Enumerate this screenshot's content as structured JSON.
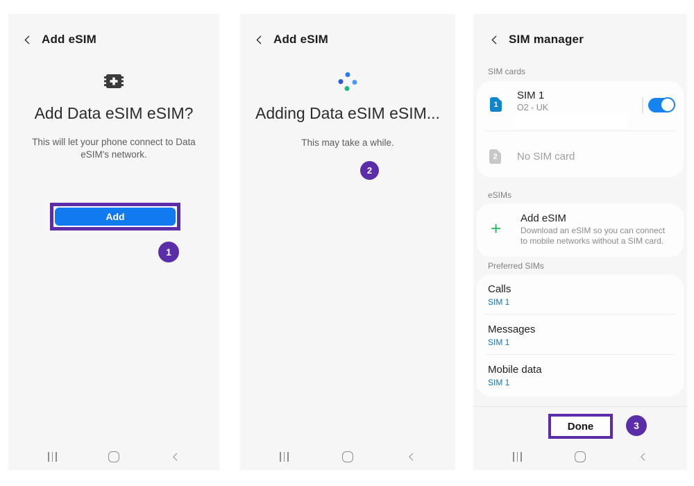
{
  "colors": {
    "accent_blue": "#127af0",
    "toggle_blue": "#1583f0",
    "sim_badge_blue": "#0e86c7",
    "plus_green": "#2eb567",
    "link_blue": "#1474c4",
    "annotation_purple": "#5b2da8",
    "spinner_top": "#2b7bf0",
    "spinner_left": "#2b59cf",
    "spinner_right": "#459bf5",
    "spinner_bottom": "#1bb97e"
  },
  "screen1": {
    "header": {
      "title": "Add eSIM"
    },
    "heading": "Add Data eSIM eSIM?",
    "body": "This will let your phone connect to Data eSIM's network.",
    "add_button": "Add",
    "badge": "1"
  },
  "screen2": {
    "header": {
      "title": "Add eSIM"
    },
    "heading": "Adding Data eSIM eSIM...",
    "body": "This may take a while.",
    "badge": "2"
  },
  "screen3": {
    "header": {
      "title": "SIM manager"
    },
    "sim_cards_label": "SIM cards",
    "sim1": {
      "badge": "1",
      "title": "SIM 1",
      "subtitle": "O2 - UK",
      "toggle_on": true
    },
    "sim2": {
      "badge": "2",
      "title": "No SIM card"
    },
    "esims_label": "eSIMs",
    "add_esim": {
      "plus": "+",
      "title": "Add eSIM",
      "subtitle": "Download an eSIM so you can connect to mobile networks without a SIM card."
    },
    "preferred_label": "Preferred SIMs",
    "preferred": [
      {
        "title": "Calls",
        "value": "SIM 1"
      },
      {
        "title": "Messages",
        "value": "SIM 1"
      },
      {
        "title": "Mobile data",
        "value": "SIM 1"
      }
    ],
    "done_button": "Done",
    "badge": "3"
  }
}
